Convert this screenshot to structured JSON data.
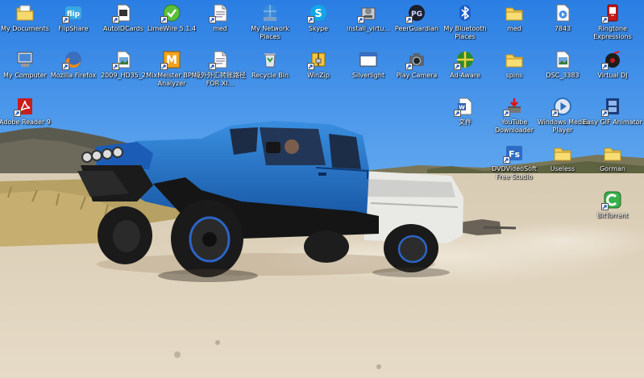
{
  "desktop": {
    "icons": [
      {
        "label": "My Documents",
        "icon": "folder-documents-icon",
        "name": "my-documents",
        "shortcut": false
      },
      {
        "label": "FlipShare",
        "icon": "flipshare-icon",
        "name": "flipshare",
        "shortcut": true
      },
      {
        "label": "AutoIDCards",
        "icon": "document-icon",
        "name": "autoidcards",
        "shortcut": true
      },
      {
        "label": "LimeWire 5.1.4",
        "icon": "limewire-icon",
        "name": "limewire",
        "shortcut": true
      },
      {
        "label": "med",
        "icon": "file-icon",
        "name": "med-file",
        "shortcut": true
      },
      {
        "label": "My Network Places",
        "icon": "network-places-icon",
        "name": "my-network-places",
        "shortcut": false
      },
      {
        "label": "Skype",
        "icon": "skype-icon",
        "name": "skype",
        "shortcut": true
      },
      {
        "label": "install_virtu...",
        "icon": "installer-icon",
        "name": "install-virtual",
        "shortcut": true
      },
      {
        "label": "PeerGuardian",
        "icon": "peerguardian-icon",
        "name": "peerguardian",
        "shortcut": true
      },
      {
        "label": "My Bluetooth Places",
        "icon": "bluetooth-icon",
        "name": "my-bluetooth-places",
        "shortcut": false
      },
      {
        "label": "med",
        "icon": "folder-icon",
        "name": "med-folder",
        "shortcut": false
      },
      {
        "label": "7843",
        "icon": "media-file-icon",
        "name": "file-7843",
        "shortcut": false
      },
      {
        "label": "Ringtone Expressions",
        "icon": "ringtone-icon",
        "name": "ringtone-expressions",
        "shortcut": true
      },
      {
        "label": "My Computer",
        "icon": "computer-icon",
        "name": "my-computer",
        "shortcut": false
      },
      {
        "label": "Mozilla Firefox",
        "icon": "firefox-icon",
        "name": "mozilla-firefox",
        "shortcut": true
      },
      {
        "label": "2009_HD35_2",
        "icon": "image-file-icon",
        "name": "file-2009-hd35",
        "shortcut": true
      },
      {
        "label": "MixMeister BPM Analyzer",
        "icon": "mixmeister-icon",
        "name": "mixmeister",
        "shortcut": true
      },
      {
        "label": "境外外汇转账路径FOR XI...",
        "icon": "file-icon",
        "name": "foreign-transfer-file",
        "shortcut": true
      },
      {
        "label": "Recycle Bin",
        "icon": "recycle-bin-icon",
        "name": "recycle-bin",
        "shortcut": false
      },
      {
        "label": "WinZip",
        "icon": "winzip-icon",
        "name": "winzip",
        "shortcut": true
      },
      {
        "label": "Silverlight",
        "icon": "window-icon",
        "name": "silverlight",
        "shortcut": false
      },
      {
        "label": "Play Camera",
        "icon": "camera-icon",
        "name": "play-camera",
        "shortcut": true
      },
      {
        "label": "Ad-Aware",
        "icon": "ad-aware-icon",
        "name": "ad-aware",
        "shortcut": true
      },
      {
        "label": "spins",
        "icon": "folder-icon",
        "name": "spins-folder",
        "shortcut": false
      },
      {
        "label": "DSC_3383",
        "icon": "image-file-icon",
        "name": "dsc-3383",
        "shortcut": false
      },
      {
        "label": "Virtual DJ",
        "icon": "virtual-dj-icon",
        "name": "virtual-dj",
        "shortcut": true
      },
      {
        "label": "Adobe Reader 9",
        "icon": "adobe-reader-icon",
        "name": "adobe-reader",
        "shortcut": true
      },
      {
        "label": "文件",
        "icon": "word-document-icon",
        "name": "chinese-document",
        "shortcut": true
      },
      {
        "label": "YouTube Downloader",
        "icon": "youtube-downloader-icon",
        "name": "youtube-downloader",
        "shortcut": true
      },
      {
        "label": "Windows Media Player",
        "icon": "media-player-icon",
        "name": "windows-media-player",
        "shortcut": true
      },
      {
        "label": "Easy GIF Animator",
        "icon": "film-icon",
        "name": "easy-gif-animator",
        "shortcut": true
      },
      {
        "label": "DVDVideoSoft Free Studio",
        "icon": "free-studio-icon",
        "name": "dvdvideosoft",
        "shortcut": true
      },
      {
        "label": "Useless",
        "icon": "folder-icon",
        "name": "useless-folder",
        "shortcut": false
      },
      {
        "label": "Gorman",
        "icon": "folder-icon",
        "name": "gorman-folder",
        "shortcut": false
      },
      {
        "label": "BitTorrent",
        "icon": "bittorrent-icon",
        "name": "bittorrent",
        "shortcut": true
      }
    ]
  }
}
